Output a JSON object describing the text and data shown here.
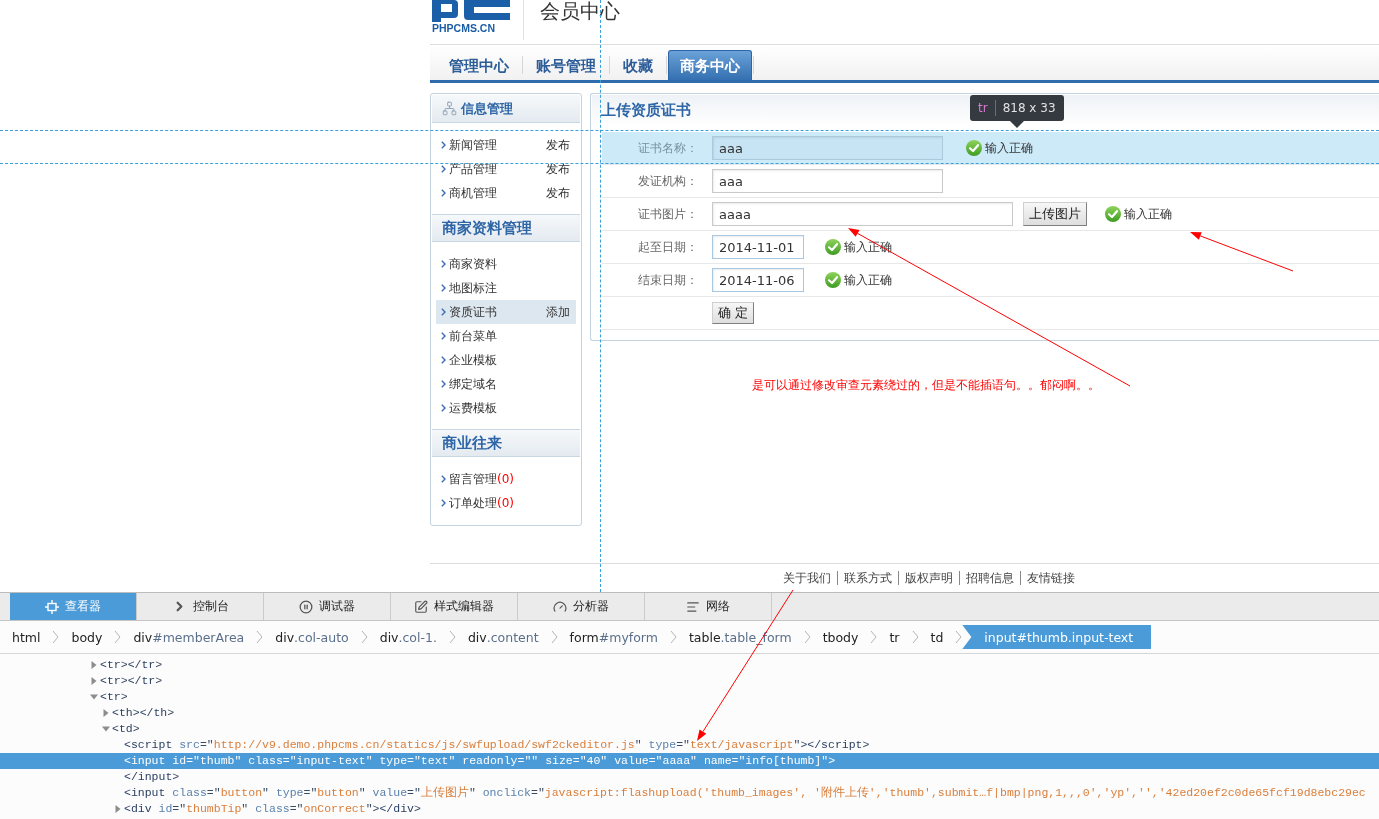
{
  "header": {
    "logo_text": "PHPCMS.CN",
    "title": "会员中心"
  },
  "nav_tabs": [
    {
      "label": "管理中心",
      "selected": false
    },
    {
      "label": "账号管理",
      "selected": false
    },
    {
      "label": "收藏",
      "selected": false
    },
    {
      "label": "商务中心",
      "selected": true
    }
  ],
  "sidebar": [
    {
      "title": "信息管理",
      "has_icon": true,
      "items": [
        {
          "label": "新闻管理",
          "action": "发布",
          "selected": false
        },
        {
          "label": "产品管理",
          "action": "发布",
          "selected": false
        },
        {
          "label": "商机管理",
          "action": "发布",
          "selected": false
        }
      ]
    },
    {
      "title": "商家资料管理",
      "has_icon": false,
      "items": [
        {
          "label": "商家资料",
          "selected": false
        },
        {
          "label": "地图标注",
          "selected": false
        },
        {
          "label": "资质证书",
          "action": "添加",
          "selected": true
        },
        {
          "label": "前台菜单",
          "selected": false
        },
        {
          "label": "企业模板",
          "selected": false
        },
        {
          "label": "绑定域名",
          "selected": false
        },
        {
          "label": "运费模板",
          "selected": false
        }
      ]
    },
    {
      "title": "商业往来",
      "has_icon": false,
      "items": [
        {
          "label": "留言管理",
          "count": "(0)",
          "selected": false
        },
        {
          "label": "订单处理",
          "count": "(0)",
          "selected": false
        }
      ]
    }
  ],
  "form": {
    "title": "上传资质证书",
    "rows": [
      {
        "kind": "text",
        "label": "证书名称：",
        "value": "aaa",
        "status": "输入正确",
        "highlighted": true
      },
      {
        "kind": "text",
        "label": "发证机构：",
        "value": "aaa",
        "highlighted": false
      },
      {
        "kind": "upload",
        "label": "证书图片：",
        "value": "aaaa",
        "button": "上传图片",
        "status": "输入正确",
        "highlighted": false
      },
      {
        "kind": "date",
        "label": "起至日期：",
        "value": "2014-11-01",
        "status": "输入正确",
        "highlighted": false
      },
      {
        "kind": "date",
        "label": "结束日期：",
        "value": "2014-11-06",
        "status": "输入正确",
        "highlighted": false
      },
      {
        "kind": "submit",
        "button": "确 定",
        "highlighted": false
      }
    ]
  },
  "inspector_tooltip": {
    "tag": "tr",
    "size": "818 x 33"
  },
  "annotation": {
    "text": "是可以通过修改审查元素绕过的，但是不能插语句。。郁闷啊。。"
  },
  "footer_links": [
    "关于我们",
    "联系方式",
    "版权声明",
    "招聘信息",
    "友情链接"
  ],
  "devtools": {
    "tabs": [
      {
        "label": "查看器",
        "selected": true
      },
      {
        "label": "控制台",
        "selected": false
      },
      {
        "label": "调试器",
        "selected": false
      },
      {
        "label": "样式编辑器",
        "selected": false
      },
      {
        "label": "分析器",
        "selected": false
      },
      {
        "label": "网络",
        "selected": false
      }
    ],
    "breadcrumbs": [
      {
        "tag": "html",
        "selected": false
      },
      {
        "tag": "body",
        "selected": false
      },
      {
        "tag": "div",
        "detail": "#memberArea",
        "selected": false
      },
      {
        "tag": "div",
        "detail": ".col-auto",
        "selected": false
      },
      {
        "tag": "div",
        "detail": ".col-1.",
        "selected": false
      },
      {
        "tag": "div",
        "detail": ".content",
        "selected": false
      },
      {
        "tag": "form",
        "detail": "#myform",
        "selected": false
      },
      {
        "tag": "table",
        "detail": ".table_form",
        "selected": false
      },
      {
        "tag": "tbody",
        "selected": false
      },
      {
        "tag": "tr",
        "selected": false
      },
      {
        "tag": "td",
        "selected": false
      },
      {
        "tag": "input",
        "detail": "#thumb.input-text",
        "selected": true
      }
    ],
    "tree": [
      {
        "text": "<tr></tr>",
        "expanded": false,
        "selected": false
      },
      {
        "text": "<tr></tr>",
        "expanded": false,
        "selected": false
      },
      {
        "text": "<tr>",
        "expanded": true,
        "selected": false,
        "children": [
          {
            "text": "<th></th>",
            "expanded": false,
            "selected": false
          },
          {
            "text": "<td>",
            "expanded": true,
            "selected": false,
            "children": [
              {
                "text": "<script src=\"http://v9.demo.phpcms.cn/statics/js/swfupload/swf2ckeditor.js\" type=\"text/javascript\"></script>",
                "selected": false
              },
              {
                "text": "<input id=\"thumb\" class=\"input-text\" type=\"text\" readonly=\"\" size=\"40\" value=\"aaaa\" name=\"info[thumb]\">",
                "selected": true
              },
              {
                "text": "</input>",
                "selected": false
              },
              {
                "text": "<input class=\"button\" type=\"button\" value=\"上传图片\" onclick=\"javascript:flashupload('thumb_images', '附件上传','thumb',submit…f|bmp|png,1,,,0','yp','','42ed20ef2c0de65fcf19d8ebc29ec",
                "selected": false
              },
              {
                "text": "<div id=\"thumbTip\" class=\"onCorrect\"></div>",
                "expanded": false,
                "selected": false
              }
            ]
          }
        ]
      }
    ]
  }
}
